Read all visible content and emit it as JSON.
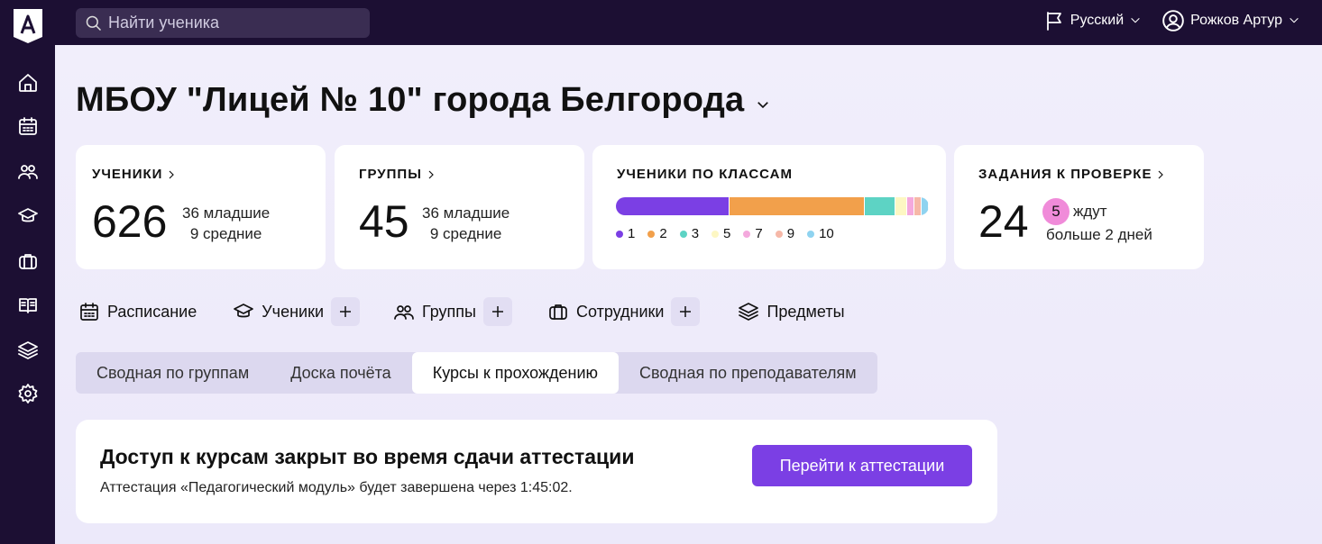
{
  "search": {
    "placeholder": "Найти ученика"
  },
  "header": {
    "language": "Русский",
    "user": "Рожков Артур"
  },
  "page": {
    "title": "МБОУ \"Лицей № 10\" города Белгорода"
  },
  "cards": {
    "students": {
      "title": "УЧЕНИКИ",
      "count": "626",
      "line1": "36 младшие",
      "line2": "9 средние"
    },
    "groups": {
      "title": "ГРУППЫ",
      "count": "45",
      "line1": "36 младшие",
      "line2": "9 средние"
    },
    "by_class": {
      "title": "УЧЕНИКИ ПО КЛАССАМ",
      "segments": [
        {
          "label": "1",
          "color": "#7b3fe4",
          "share": 120
        },
        {
          "label": "2",
          "color": "#f2a04b",
          "share": 143
        },
        {
          "label": "3",
          "color": "#5dd3c4",
          "share": 33
        },
        {
          "label": "5",
          "color": "#fdf7c3",
          "share": 12
        },
        {
          "label": "7",
          "color": "#f4a9dd",
          "share": 8
        },
        {
          "label": "9",
          "color": "#f6b8a8",
          "share": 7
        },
        {
          "label": "10",
          "color": "#8fd3f0",
          "share": 8
        }
      ]
    },
    "tasks": {
      "title": "ЗАДАНИЯ К ПРОВЕРКЕ",
      "count": "24",
      "badge": "5",
      "line1": "ждут",
      "line2": "больше 2 дней"
    }
  },
  "quick_links": {
    "schedule": "Расписание",
    "students": "Ученики",
    "groups": "Группы",
    "staff": "Сотрудники",
    "subjects": "Предметы"
  },
  "tabs": [
    {
      "label": "Сводная по группам",
      "active": false
    },
    {
      "label": "Доска почёта",
      "active": false
    },
    {
      "label": "Курсы к прохождению",
      "active": true
    },
    {
      "label": "Сводная по преподавателям",
      "active": false
    }
  ],
  "access": {
    "title": "Доступ к курсам закрыт во время сдачи аттестации",
    "subtitle": "Аттестация «Педагогический модуль» будет завершена через 1:45:02.",
    "button": "Перейти к аттестации"
  }
}
